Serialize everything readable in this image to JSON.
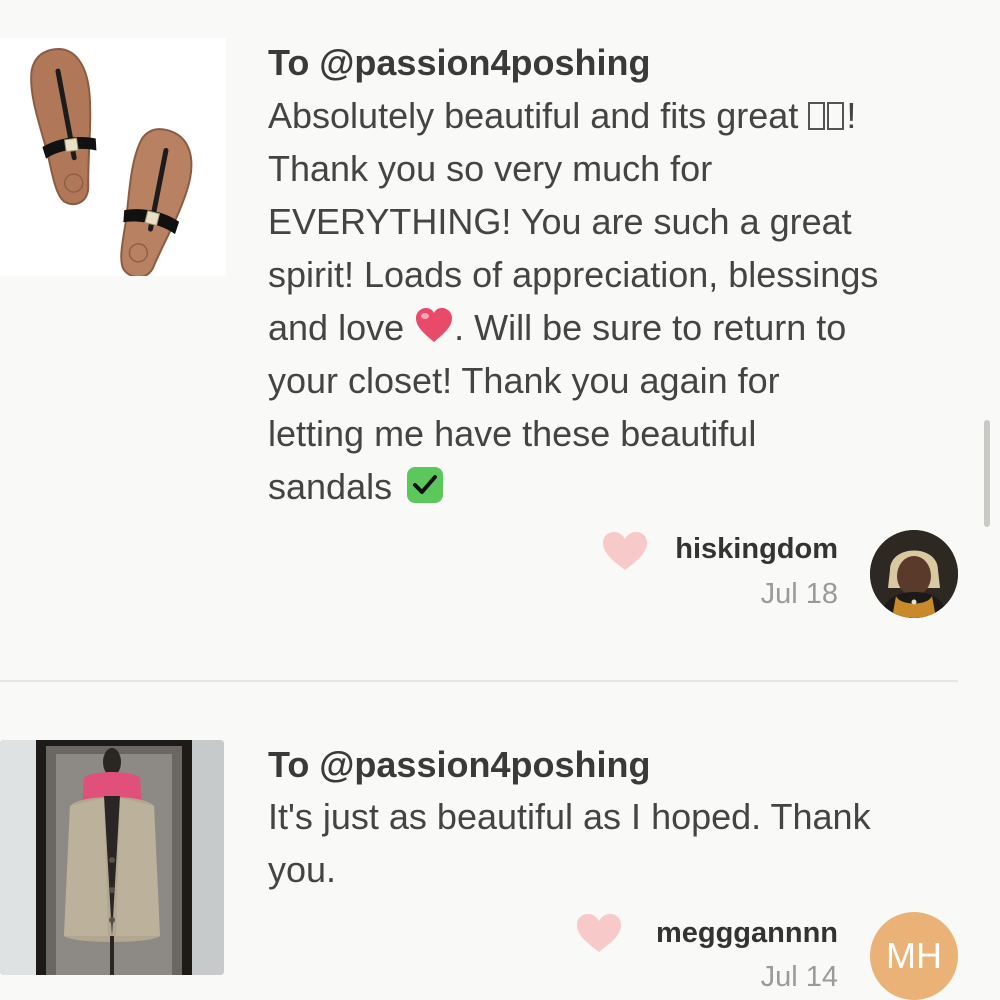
{
  "reviews": [
    {
      "recipient": "To @passion4poshing",
      "message_lines": [
        "Absolutely beautiful and fits great ",
        "Thank you so very much for",
        "EVERYTHING! You are such a great",
        "spirit! Loads of appreciation, blessings",
        "and love ",
        "your closet! Thank you again for",
        "letting me have these beautiful",
        "sandals "
      ],
      "line1_suffix": "!",
      "line5_suffix": ". Will be sure to return to",
      "username": "hiskingdom",
      "date": "Jul 18",
      "thumbnail_icon": "sandals-image",
      "avatar_icon": "user-photo"
    },
    {
      "recipient": "To @passion4poshing",
      "message_lines": [
        "It's just as beautiful as I hoped. Thank",
        "you."
      ],
      "username": "megggannnn",
      "date": "Jul 14",
      "avatar_initials": "MH",
      "thumbnail_icon": "cardigan-image"
    }
  ],
  "colors": {
    "background": "#f9f9f7",
    "like_heart": "#f8c9c9",
    "avatar_initials_bg": "#eab276",
    "date_text": "#9a9a9a"
  },
  "icons": [
    "heart-emoji-icon",
    "check-mark-emoji-icon",
    "like-heart-icon"
  ]
}
